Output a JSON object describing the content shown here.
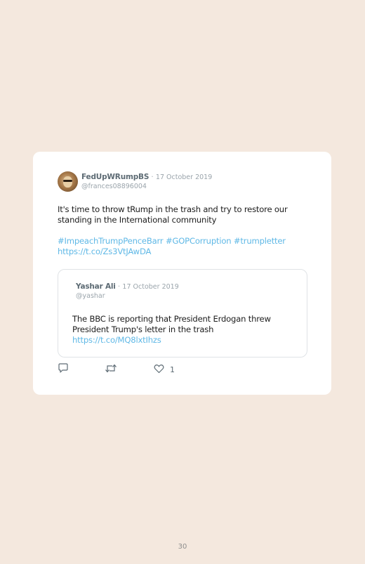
{
  "tweet": {
    "author_name": "FedUpWRumpBS",
    "date_separator": "·",
    "date": "17 October 2019",
    "handle": "@frances08896004",
    "text": "It's time to throw tRump in the trash and try to restore our standing in the International community",
    "hashtags": [
      "#ImpeachTrumpPenceBarr",
      "#GOPCorruption",
      "#trumpletter"
    ],
    "link": "https://t.co/Zs3VtJAwDA",
    "avatar_icon": "profile-photo",
    "quoted": {
      "author_name": "Yashar Ali",
      "date_separator": "·",
      "date": "17 October 2019",
      "handle": "@yashar",
      "text": "The BBC is reporting that President Erdogan threw President Trump's letter in the trash",
      "link": "https://t.co/MQ8lxtIhzs"
    },
    "actions": {
      "reply_icon": "reply-icon",
      "retweet_icon": "retweet-icon",
      "like_icon": "heart-icon",
      "like_count": "1"
    }
  },
  "page_number": "30",
  "colors": {
    "background": "#f4e8de",
    "card": "#ffffff",
    "link": "#5fb8e6",
    "muted": "#9aa4ab"
  }
}
